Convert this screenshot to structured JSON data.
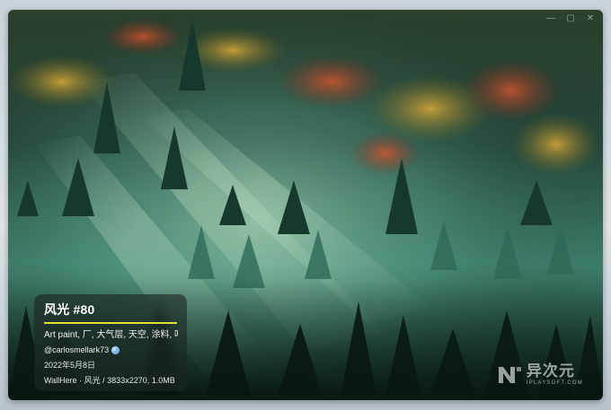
{
  "card": {
    "title": "风光 #80",
    "tags": "Art paint, 厂, 大气层, 天空, 涂料, 叶",
    "author": "@carlosmellark73",
    "date": "2022年5月8日",
    "source": "WallHere · 风光 / 3833x2270, 1.0MB"
  },
  "window_controls": [
    "—",
    "▢",
    "✕"
  ],
  "watermark": {
    "cn": "异次元",
    "en": "IPLAYSOFT.COM"
  },
  "colors": {
    "accent_rule": "#dfe42b",
    "card_bg": "rgba(28,38,36,0.62)",
    "forest_dark": "#0f231c",
    "mist": "#6fb3a1"
  },
  "icons": {
    "author_badge": "globe-icon",
    "watermark_logo": "iplaysoft-logo-icon"
  }
}
